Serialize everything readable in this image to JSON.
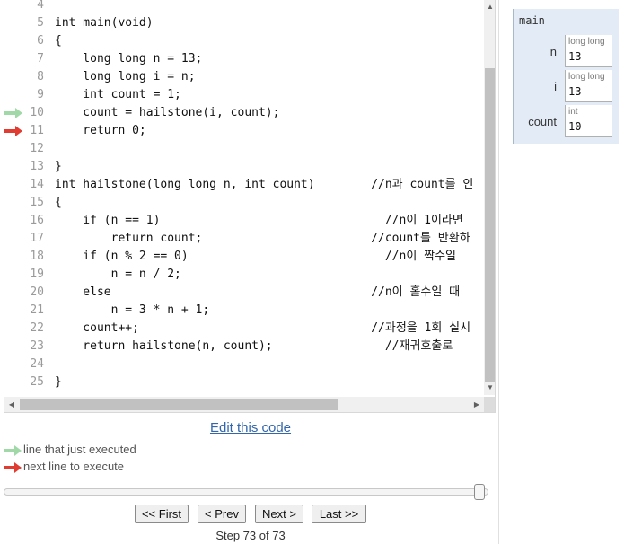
{
  "code": {
    "lines": [
      {
        "number": "4",
        "text": ""
      },
      {
        "number": "5",
        "text": "int main(void)"
      },
      {
        "number": "6",
        "text": "{"
      },
      {
        "number": "7",
        "text": "    long long n = 13;"
      },
      {
        "number": "8",
        "text": "    long long i = n;"
      },
      {
        "number": "9",
        "text": "    int count = 1;"
      },
      {
        "number": "10",
        "text": "    count = hailstone(i, count);",
        "marker": "prev"
      },
      {
        "number": "11",
        "text": "    return 0;",
        "marker": "next"
      },
      {
        "number": "12",
        "text": ""
      },
      {
        "number": "13",
        "text": "}"
      },
      {
        "number": "14",
        "text": "int hailstone(long long n, int count)        //n과 count를 인"
      },
      {
        "number": "15",
        "text": "{"
      },
      {
        "number": "16",
        "text": "    if (n == 1)                                //n이 1이라면"
      },
      {
        "number": "17",
        "text": "        return count;                        //count를 반환하"
      },
      {
        "number": "18",
        "text": "    if (n % 2 == 0)                            //n이 짝수일"
      },
      {
        "number": "19",
        "text": "        n = n / 2;"
      },
      {
        "number": "20",
        "text": "    else                                     //n이 홀수일 때"
      },
      {
        "number": "21",
        "text": "        n = 3 * n + 1;"
      },
      {
        "number": "22",
        "text": "    count++;                                 //과정을 1회 실시"
      },
      {
        "number": "23",
        "text": "    return hailstone(n, count);                //재귀호출로"
      },
      {
        "number": "24",
        "text": ""
      },
      {
        "number": "25",
        "text": "}"
      }
    ]
  },
  "edit_link": "Edit this code",
  "legend": {
    "prev_label": "line that just executed",
    "next_label": "next line to execute",
    "prev_color": "#a0d8a8",
    "next_color": "#e03c31"
  },
  "slider": {
    "fraction": 1.0
  },
  "nav": {
    "first": "<< First",
    "prev": "< Prev",
    "next": "Next >",
    "last": "Last >>"
  },
  "step_text": "Step 73 of 73",
  "frame": {
    "title": "main",
    "vars": [
      {
        "name": "n",
        "type": "long long",
        "value": "13"
      },
      {
        "name": "i",
        "type": "long long",
        "value": "13"
      },
      {
        "name": "count",
        "type": "int",
        "value": "10"
      }
    ]
  },
  "icons": {
    "scroll_up": "triangle-up",
    "scroll_down": "triangle-down",
    "scroll_left": "triangle-left",
    "scroll_right": "triangle-right"
  }
}
